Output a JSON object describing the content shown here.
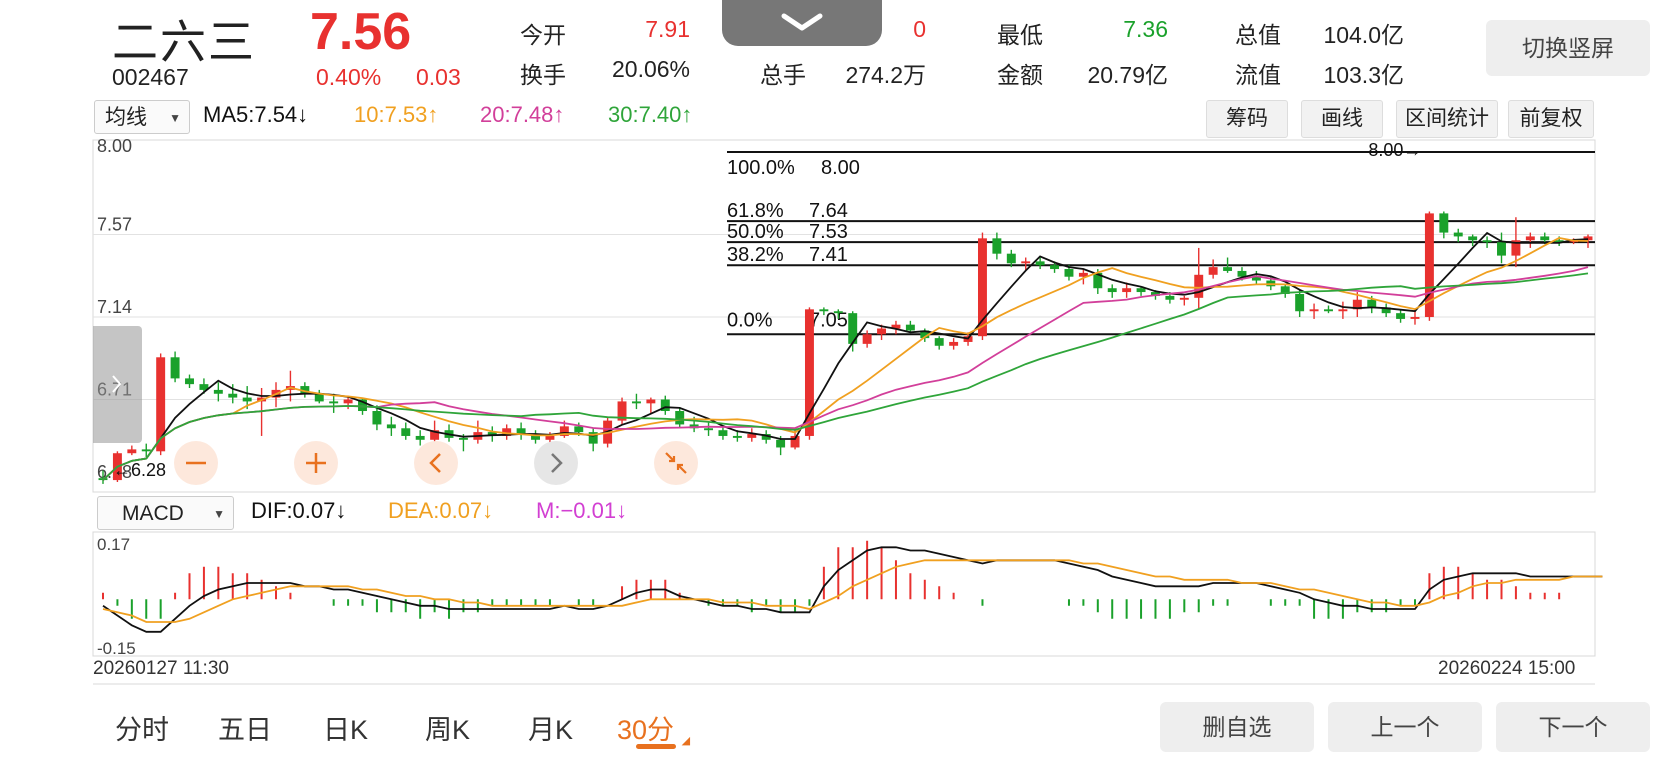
{
  "header": {
    "stock_name": "二六三",
    "stock_code": "002467",
    "price": "7.56",
    "change_pct": "0.40%",
    "change_abs": "0.03",
    "stats": [
      {
        "label": "今开",
        "value": "7.91",
        "color": "red"
      },
      {
        "label": "换手",
        "value": "20.06%",
        "color": "black"
      },
      {
        "label": "总手",
        "value": "274.2万",
        "color": "black"
      },
      {
        "label": "最低",
        "value": "7.36",
        "color": "green"
      },
      {
        "label": "金额",
        "value": "20.79亿",
        "color": "black"
      },
      {
        "label": "总值",
        "value": "104.0亿",
        "color": "black"
      },
      {
        "label": "流值",
        "value": "103.3亿",
        "color": "black"
      }
    ],
    "partial_hidden_value": "0",
    "switch_button": "切换竖屏"
  },
  "toolbar": {
    "ma_select": "均线",
    "ma5": "MA5:7.54↓",
    "ma10": "10:7.53↑",
    "ma20": "20:7.48↑",
    "ma30": "30:7.40↑",
    "buttons": [
      "筹码",
      "画线",
      "区间统计",
      "前复权"
    ]
  },
  "macd_bar": {
    "select": "MACD",
    "dif": "DIF:0.07↓",
    "dea": "DEA:0.07↓",
    "m": "M:−0.01↓"
  },
  "colors": {
    "up": "#e8312f",
    "down": "#1aa12b",
    "ma5": "#111111",
    "ma10": "#f0a020",
    "ma20": "#d23f9a",
    "ma30": "#2fa53a",
    "dea": "#f0a020"
  },
  "controls": {
    "icons": [
      "minus-icon",
      "plus-icon",
      "chevron-left-icon",
      "chevron-right-icon",
      "collapse-icon"
    ]
  },
  "period_tabs": [
    "分时",
    "五日",
    "日K",
    "周K",
    "月K",
    "30分"
  ],
  "active_period": "30分",
  "bottom_buttons": [
    "删自选",
    "上一个",
    "下一个"
  ],
  "chart_data": {
    "type": "candlestick",
    "price_axis": {
      "ticks": [
        "8.00",
        "7.57",
        "7.14",
        "6.71",
        "6.28"
      ],
      "ylim": [
        6.28,
        8.0
      ]
    },
    "x_range": {
      "start": "20260127 11:30",
      "end": "20260224 15:00"
    },
    "fibonacci_levels": [
      {
        "label": "100.0%",
        "price": "8.00",
        "value": 8.0
      },
      {
        "label": "61.8%",
        "price": "7.64",
        "value": 7.64
      },
      {
        "label": "50.0%",
        "price": "7.53",
        "value": 7.53
      },
      {
        "label": "38.2%",
        "price": "7.41",
        "value": 7.41
      },
      {
        "label": "0.0%",
        "price": "7.05",
        "value": 7.05
      }
    ],
    "annotations": {
      "high_marker": "8.00→",
      "low_marker": "←6.28"
    },
    "candles": [
      [
        6.3,
        6.34,
        6.27,
        6.29
      ],
      [
        6.29,
        6.44,
        6.28,
        6.43
      ],
      [
        6.43,
        6.47,
        6.42,
        6.45
      ],
      [
        6.45,
        6.48,
        6.41,
        6.44
      ],
      [
        6.44,
        6.95,
        6.42,
        6.93
      ],
      [
        6.93,
        6.96,
        6.8,
        6.82
      ],
      [
        6.82,
        6.84,
        6.77,
        6.79
      ],
      [
        6.79,
        6.82,
        6.74,
        6.76
      ],
      [
        6.76,
        6.8,
        6.7,
        6.74
      ],
      [
        6.74,
        6.79,
        6.69,
        6.72
      ],
      [
        6.72,
        6.78,
        6.66,
        6.7
      ],
      [
        6.7,
        6.77,
        6.52,
        6.72
      ],
      [
        6.72,
        6.8,
        6.67,
        6.76
      ],
      [
        6.76,
        6.86,
        6.7,
        6.78
      ],
      [
        6.78,
        6.8,
        6.72,
        6.74
      ],
      [
        6.74,
        6.76,
        6.69,
        6.7
      ],
      [
        6.7,
        6.74,
        6.64,
        6.69
      ],
      [
        6.69,
        6.73,
        6.66,
        6.71
      ],
      [
        6.71,
        6.72,
        6.63,
        6.65
      ],
      [
        6.65,
        6.68,
        6.55,
        6.58
      ],
      [
        6.58,
        6.62,
        6.52,
        6.56
      ],
      [
        6.56,
        6.59,
        6.5,
        6.52
      ],
      [
        6.52,
        6.55,
        6.47,
        6.5
      ],
      [
        6.5,
        6.6,
        6.48,
        6.55
      ],
      [
        6.55,
        6.58,
        6.49,
        6.51
      ],
      [
        6.51,
        6.53,
        6.44,
        6.5
      ],
      [
        6.5,
        6.6,
        6.48,
        6.54
      ],
      [
        6.54,
        6.57,
        6.49,
        6.52
      ],
      [
        6.52,
        6.58,
        6.5,
        6.56
      ],
      [
        6.56,
        6.59,
        6.5,
        6.53
      ],
      [
        6.53,
        6.55,
        6.48,
        6.5
      ],
      [
        6.5,
        6.54,
        6.47,
        6.52
      ],
      [
        6.52,
        6.6,
        6.51,
        6.57
      ],
      [
        6.57,
        6.59,
        6.52,
        6.54
      ],
      [
        6.54,
        6.56,
        6.44,
        6.48
      ],
      [
        6.48,
        6.62,
        6.46,
        6.6
      ],
      [
        6.6,
        6.72,
        6.58,
        6.7
      ],
      [
        6.7,
        6.74,
        6.66,
        6.69
      ],
      [
        6.69,
        6.72,
        6.64,
        6.71
      ],
      [
        6.71,
        6.73,
        6.63,
        6.65
      ],
      [
        6.65,
        6.67,
        6.56,
        6.58
      ],
      [
        6.58,
        6.62,
        6.54,
        6.56
      ],
      [
        6.56,
        6.59,
        6.52,
        6.55
      ],
      [
        6.55,
        6.57,
        6.5,
        6.52
      ],
      [
        6.52,
        6.55,
        6.49,
        6.51
      ],
      [
        6.51,
        6.56,
        6.49,
        6.53
      ],
      [
        6.53,
        6.55,
        6.48,
        6.5
      ],
      [
        6.5,
        6.52,
        6.42,
        6.46
      ],
      [
        6.46,
        6.55,
        6.45,
        6.52
      ],
      [
        6.52,
        7.19,
        6.5,
        7.18
      ],
      [
        7.18,
        7.19,
        7.15,
        7.17
      ],
      [
        7.17,
        7.18,
        7.13,
        7.16
      ],
      [
        7.16,
        7.17,
        6.96,
        7.0
      ],
      [
        7.0,
        7.07,
        6.98,
        7.05
      ],
      [
        7.05,
        7.1,
        7.02,
        7.08
      ],
      [
        7.08,
        7.12,
        7.05,
        7.1
      ],
      [
        7.1,
        7.12,
        7.06,
        7.07
      ],
      [
        7.07,
        7.08,
        7.01,
        7.03
      ],
      [
        7.03,
        7.04,
        6.97,
        6.99
      ],
      [
        6.99,
        7.03,
        6.97,
        7.01
      ],
      [
        7.01,
        7.06,
        6.99,
        7.04
      ],
      [
        7.04,
        7.58,
        7.02,
        7.55
      ],
      [
        7.55,
        7.58,
        7.44,
        7.47
      ],
      [
        7.47,
        7.49,
        7.4,
        7.42
      ],
      [
        7.42,
        7.45,
        7.38,
        7.43
      ],
      [
        7.43,
        7.45,
        7.39,
        7.41
      ],
      [
        7.41,
        7.43,
        7.37,
        7.39
      ],
      [
        7.39,
        7.41,
        7.33,
        7.35
      ],
      [
        7.35,
        7.39,
        7.31,
        7.37
      ],
      [
        7.37,
        7.39,
        7.26,
        7.29
      ],
      [
        7.29,
        7.31,
        7.24,
        7.27
      ],
      [
        7.27,
        7.32,
        7.24,
        7.29
      ],
      [
        7.29,
        7.3,
        7.25,
        7.27
      ],
      [
        7.27,
        7.28,
        7.23,
        7.25
      ],
      [
        7.25,
        7.27,
        7.21,
        7.23
      ],
      [
        7.23,
        7.25,
        7.2,
        7.24
      ],
      [
        7.24,
        7.5,
        7.18,
        7.36
      ],
      [
        7.36,
        7.44,
        7.34,
        7.4
      ],
      [
        7.4,
        7.45,
        7.37,
        7.38
      ],
      [
        7.38,
        7.4,
        7.33,
        7.35
      ],
      [
        7.35,
        7.38,
        7.31,
        7.33
      ],
      [
        7.33,
        7.35,
        7.28,
        7.3
      ],
      [
        7.3,
        7.31,
        7.24,
        7.26
      ],
      [
        7.26,
        7.28,
        7.14,
        7.17
      ],
      [
        7.17,
        7.21,
        7.13,
        7.18
      ],
      [
        7.18,
        7.2,
        7.16,
        7.17
      ],
      [
        7.17,
        7.22,
        7.13,
        7.18
      ],
      [
        7.18,
        7.27,
        7.14,
        7.23
      ],
      [
        7.23,
        7.25,
        7.16,
        7.19
      ],
      [
        7.19,
        7.21,
        7.14,
        7.16
      ],
      [
        7.16,
        7.18,
        7.11,
        7.13
      ],
      [
        7.13,
        7.18,
        7.1,
        7.14
      ],
      [
        7.14,
        7.69,
        7.12,
        7.68
      ],
      [
        7.68,
        7.69,
        7.55,
        7.58
      ],
      [
        7.58,
        7.6,
        7.53,
        7.56
      ],
      [
        7.56,
        7.57,
        7.51,
        7.54
      ],
      [
        7.54,
        7.56,
        7.5,
        7.53
      ],
      [
        7.53,
        7.58,
        7.42,
        7.46
      ],
      [
        7.46,
        7.66,
        7.4,
        7.54
      ],
      [
        7.54,
        7.58,
        7.5,
        7.56
      ],
      [
        7.56,
        7.58,
        7.52,
        7.54
      ],
      [
        7.54,
        7.56,
        7.51,
        7.53
      ],
      [
        7.53,
        7.55,
        7.52,
        7.54
      ],
      [
        7.54,
        7.57,
        7.5,
        7.56
      ]
    ],
    "macd": {
      "ylim": [
        -0.15,
        0.17
      ],
      "dif": [
        -0.02,
        -0.05,
        -0.08,
        -0.1,
        -0.1,
        -0.06,
        -0.02,
        0.01,
        0.03,
        0.04,
        0.05,
        0.05,
        0.05,
        0.05,
        0.04,
        0.04,
        0.03,
        0.03,
        0.02,
        0.01,
        0.0,
        -0.01,
        -0.02,
        -0.02,
        -0.03,
        -0.03,
        -0.03,
        -0.03,
        -0.03,
        -0.03,
        -0.03,
        -0.03,
        -0.02,
        -0.03,
        -0.03,
        -0.02,
        0.0,
        0.02,
        0.03,
        0.03,
        0.01,
        0.0,
        -0.01,
        -0.02,
        -0.02,
        -0.03,
        -0.03,
        -0.04,
        -0.04,
        -0.04,
        0.04,
        0.09,
        0.12,
        0.15,
        0.16,
        0.16,
        0.15,
        0.15,
        0.14,
        0.13,
        0.12,
        0.11,
        0.12,
        0.12,
        0.12,
        0.12,
        0.12,
        0.11,
        0.1,
        0.09,
        0.07,
        0.06,
        0.05,
        0.04,
        0.04,
        0.04,
        0.04,
        0.05,
        0.05,
        0.05,
        0.05,
        0.04,
        0.03,
        0.02,
        0.0,
        -0.01,
        -0.02,
        -0.02,
        -0.03,
        -0.03,
        -0.03,
        -0.03,
        0.03,
        0.06,
        0.07,
        0.08,
        0.08,
        0.08,
        0.08,
        0.07,
        0.07,
        0.07,
        0.07,
        0.07,
        0.07
      ],
      "dea": [
        -0.03,
        -0.04,
        -0.05,
        -0.07,
        -0.07,
        -0.07,
        -0.06,
        -0.04,
        -0.02,
        0.0,
        0.01,
        0.02,
        0.03,
        0.04,
        0.04,
        0.04,
        0.04,
        0.04,
        0.03,
        0.03,
        0.02,
        0.01,
        0.01,
        0.0,
        0.0,
        -0.01,
        -0.01,
        -0.02,
        -0.02,
        -0.02,
        -0.02,
        -0.02,
        -0.02,
        -0.02,
        -0.02,
        -0.02,
        -0.02,
        -0.01,
        0.0,
        0.0,
        0.0,
        0.0,
        0.0,
        -0.01,
        -0.01,
        -0.01,
        -0.02,
        -0.02,
        -0.02,
        -0.03,
        -0.01,
        0.01,
        0.04,
        0.06,
        0.08,
        0.1,
        0.11,
        0.12,
        0.12,
        0.12,
        0.12,
        0.12,
        0.12,
        0.12,
        0.12,
        0.12,
        0.12,
        0.12,
        0.11,
        0.11,
        0.1,
        0.09,
        0.08,
        0.07,
        0.07,
        0.06,
        0.06,
        0.06,
        0.06,
        0.05,
        0.05,
        0.05,
        0.04,
        0.03,
        0.03,
        0.02,
        0.01,
        0.0,
        -0.01,
        -0.01,
        -0.02,
        -0.02,
        -0.01,
        0.01,
        0.02,
        0.04,
        0.05,
        0.05,
        0.06,
        0.06,
        0.06,
        0.06,
        0.07,
        0.07,
        0.07
      ]
    }
  }
}
